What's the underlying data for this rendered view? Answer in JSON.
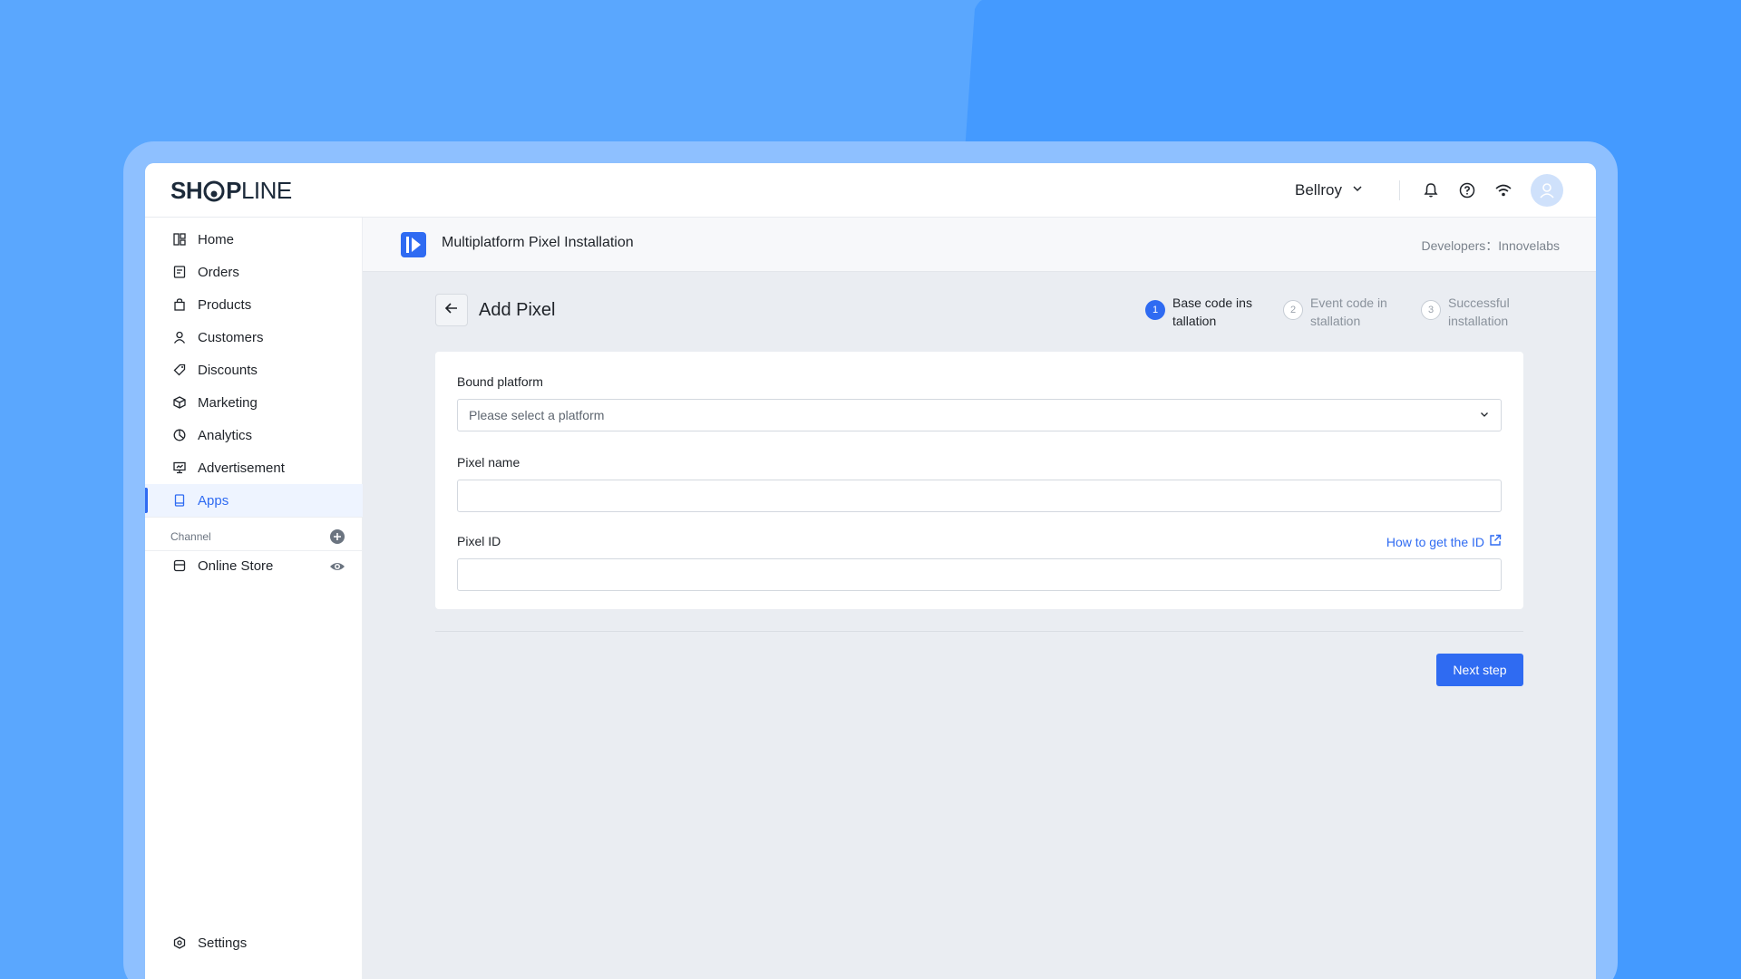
{
  "brand": {
    "logo_left": "SH",
    "logo_mid": "P",
    "logo_right": "LINE"
  },
  "header": {
    "store_name": "Bellroy",
    "icons": [
      "bell-icon",
      "help-icon",
      "wifi-icon",
      "avatar-icon"
    ]
  },
  "sidebar": {
    "items": [
      {
        "label": "Home",
        "icon": "home-icon"
      },
      {
        "label": "Orders",
        "icon": "orders-icon"
      },
      {
        "label": "Products",
        "icon": "products-icon"
      },
      {
        "label": "Customers",
        "icon": "customers-icon"
      },
      {
        "label": "Discounts",
        "icon": "discounts-icon"
      },
      {
        "label": "Marketing",
        "icon": "marketing-icon"
      },
      {
        "label": "Analytics",
        "icon": "analytics-icon"
      },
      {
        "label": "Advertisement",
        "icon": "advertisement-icon"
      },
      {
        "label": "Apps",
        "icon": "apps-icon",
        "active": true
      }
    ],
    "channel_label": "Channel",
    "channel_items": [
      {
        "label": "Online Store",
        "icon": "store-icon"
      }
    ],
    "settings_label": "Settings"
  },
  "app": {
    "title": "Multiplatform Pixel Installation",
    "developer": "Developers：Innovelabs"
  },
  "page": {
    "title": "Add Pixel",
    "steps": [
      {
        "num": "1",
        "label": "Base code ins tallation",
        "state": "active"
      },
      {
        "num": "2",
        "label": "Event code in stallation",
        "state": "pending"
      },
      {
        "num": "3",
        "label": "Successful installation",
        "state": "pending"
      }
    ]
  },
  "form": {
    "platform_label": "Bound platform",
    "platform_placeholder": "Please select a platform",
    "pixel_name_label": "Pixel name",
    "pixel_name_value": "",
    "pixel_id_label": "Pixel ID",
    "pixel_id_value": "",
    "howto_link": "How to get the ID"
  },
  "actions": {
    "next_label": "Next step"
  },
  "colors": {
    "accent": "#2f6bf2",
    "background": "#5aa7fe"
  }
}
